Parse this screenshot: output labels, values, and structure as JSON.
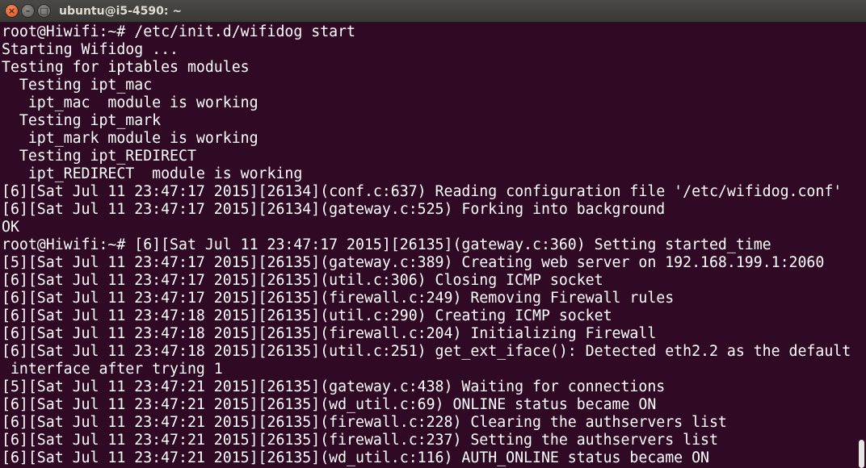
{
  "window": {
    "title": "ubuntu@i5-4590: ~",
    "buttons": {
      "close": "×",
      "minimize": "–",
      "maximize": "□"
    }
  },
  "terminal": {
    "lines": [
      "root@Hiwifi:~# /etc/init.d/wifidog start",
      "Starting Wifidog ...",
      "Testing for iptables modules",
      "  Testing ipt_mac",
      "   ipt_mac  module is working",
      "  Testing ipt_mark",
      "   ipt_mark module is working",
      "  Testing ipt_REDIRECT",
      "   ipt_REDIRECT  module is working",
      "[6][Sat Jul 11 23:47:17 2015][26134](conf.c:637) Reading configuration file '/etc/wifidog.conf'",
      "[6][Sat Jul 11 23:47:17 2015][26134](gateway.c:525) Forking into background",
      "OK",
      "root@Hiwifi:~# [6][Sat Jul 11 23:47:17 2015][26135](gateway.c:360) Setting started_time",
      "[5][Sat Jul 11 23:47:17 2015][26135](gateway.c:389) Creating web server on 192.168.199.1:2060",
      "[6][Sat Jul 11 23:47:17 2015][26135](util.c:306) Closing ICMP socket",
      "[6][Sat Jul 11 23:47:17 2015][26135](firewall.c:249) Removing Firewall rules",
      "[6][Sat Jul 11 23:47:18 2015][26135](util.c:290) Creating ICMP socket",
      "[6][Sat Jul 11 23:47:18 2015][26135](firewall.c:204) Initializing Firewall",
      "[6][Sat Jul 11 23:47:18 2015][26135](util.c:251) get_ext_iface(): Detected eth2.2 as the default",
      " interface after trying 1",
      "[5][Sat Jul 11 23:47:21 2015][26135](gateway.c:438) Waiting for connections",
      "[6][Sat Jul 11 23:47:21 2015][26135](wd_util.c:69) ONLINE status became ON",
      "[6][Sat Jul 11 23:47:21 2015][26135](firewall.c:228) Clearing the authservers list",
      "[6][Sat Jul 11 23:47:21 2015][26135](firewall.c:237) Setting the authservers list",
      "[6][Sat Jul 11 23:47:21 2015][26135](wd_util.c:116) AUTH_ONLINE status became ON"
    ]
  },
  "colors": {
    "background": "#300a24",
    "text": "#ffffff",
    "titlebar": "#3c3b37",
    "close_button": "#e2501f"
  }
}
